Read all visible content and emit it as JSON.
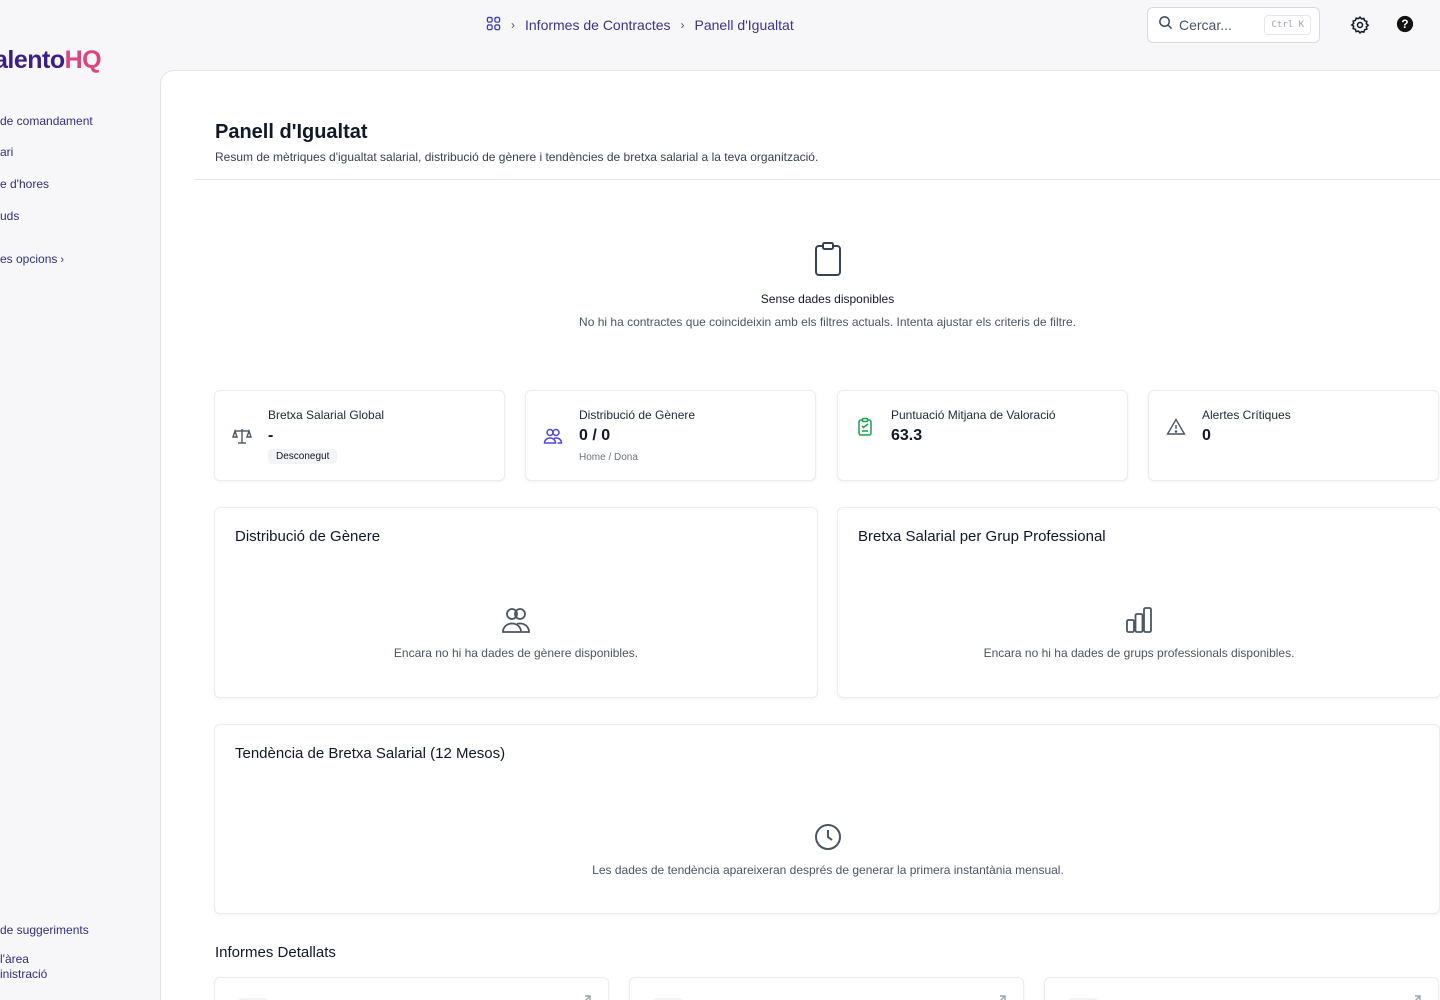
{
  "sidebar": {
    "logo_main": "alento",
    "logo_accent": "HQ",
    "items": [
      {
        "label": "de comandament"
      },
      {
        "label": "ari"
      },
      {
        "label": "e d'hores"
      },
      {
        "label": "uds"
      }
    ],
    "more_label": "es opcions",
    "bottom": [
      {
        "label": "de suggeriments"
      },
      {
        "label_line1": "l'àrea",
        "label_line2": "inistració"
      }
    ]
  },
  "breadcrumb": {
    "home_icon": "grid-icon",
    "items": [
      "Informes de Contractes",
      "Panell d'Igualtat"
    ]
  },
  "search": {
    "placeholder": "Cercar...",
    "shortcut": "Ctrl K"
  },
  "header_icons": [
    "settings-icon",
    "help-icon"
  ],
  "page": {
    "title": "Panell d'Igualtat",
    "subtitle": "Resum de mètriques d'igualtat salarial, distribució de gènere i tendències de bretxa salarial a la teva organització."
  },
  "empty_state": {
    "icon": "clipboard-icon",
    "title": "Sense dades disponibles",
    "description": "No hi ha contractes que coincideixin amb els filtres actuals. Intenta ajustar els criteris de filtre."
  },
  "stats": [
    {
      "icon": "scale-icon",
      "label": "Bretxa Salarial Global",
      "value": "-",
      "badge": "Desconegut"
    },
    {
      "icon": "users-icon",
      "label": "Distribució de Gènere",
      "value": "0 / 0",
      "hint": "Home / Dona"
    },
    {
      "icon": "clipboard-check-icon",
      "label": "Puntuació Mitjana de Valoració",
      "value": "63.3"
    },
    {
      "icon": "warning-icon",
      "label": "Alertes Crítiques",
      "value": "0"
    }
  ],
  "panels": {
    "gender": {
      "title": "Distribució de Gènere",
      "message": "Encara no hi ha dades de gènere disponibles."
    },
    "groups": {
      "title": "Bretxa Salarial per Grup Professional",
      "message": "Encara no hi ha dades de grups professionals disponibles."
    },
    "trend": {
      "title": "Tendència de Bretxa Salarial (12 Mesos)",
      "message": "Les dades de tendència apareixeran després de generar la primera instantània mensual."
    }
  },
  "reports": {
    "title": "Informes Detallats"
  },
  "colors": {
    "accent": "#3b1d8f",
    "brand_pink": "#e0457a",
    "green": "#16a34a",
    "indigo": "#4f46e5"
  }
}
